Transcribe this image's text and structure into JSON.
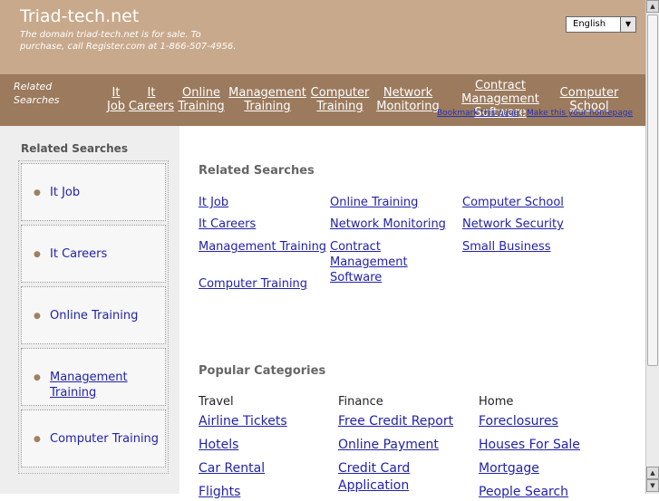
{
  "header": {
    "title": "Triad-tech.net",
    "description": "The domain triad-tech.net is for sale. To purchase, call Register.com at 1-866-507-4956.",
    "language": "English"
  },
  "nav": {
    "label": [
      "Related",
      "Searches"
    ],
    "links": [
      {
        "lines": [
          "It",
          "Job"
        ]
      },
      {
        "lines": [
          "It",
          "Careers"
        ]
      },
      {
        "lines": [
          "Online",
          "Training"
        ]
      },
      {
        "lines": [
          "Management",
          "Training"
        ]
      },
      {
        "lines": [
          "Computer",
          "Training"
        ]
      },
      {
        "lines": [
          "Network",
          "Monitoring"
        ]
      },
      {
        "lines": [
          "Contract",
          "Management",
          "Software"
        ]
      },
      {
        "lines": [
          "Computer",
          "School"
        ]
      }
    ],
    "bookmark": "Bookmark this page",
    "separator": "|",
    "homepage": "Make this your homepage"
  },
  "sidebar": {
    "title": "Related Searches",
    "items": [
      {
        "label": "It Job"
      },
      {
        "label": "It Careers"
      },
      {
        "label": "Online Training"
      },
      {
        "label": "Management Training"
      },
      {
        "label": "Computer Training"
      }
    ]
  },
  "related": {
    "title": "Related Searches",
    "links": [
      "It Job",
      "Online Training",
      "Computer School",
      "It Careers",
      "Network Monitoring",
      "Network Security",
      "Management Training",
      "Contract Management Software",
      "Small Business",
      "Computer Training"
    ]
  },
  "popular": {
    "title": "Popular Categories",
    "columns": [
      {
        "heading": "Travel",
        "links": [
          "Airline Tickets",
          "Hotels",
          "Car Rental",
          "Flights"
        ]
      },
      {
        "heading": "Finance",
        "links": [
          "Free Credit Report",
          "Online Payment",
          "Credit Card Application"
        ]
      },
      {
        "heading": "Home",
        "links": [
          "Foreclosures",
          "Houses For Sale",
          "Mortgage",
          "People Search"
        ]
      }
    ]
  }
}
